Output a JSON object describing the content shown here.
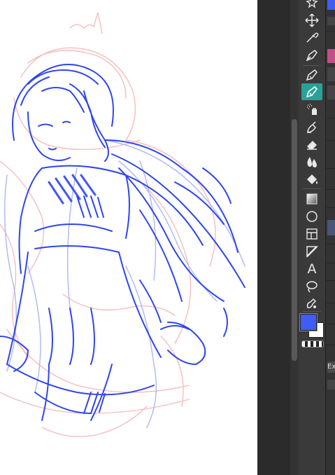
{
  "toolbar": {
    "tools": [
      {
        "name": "magic-wand-icon"
      },
      {
        "name": "move-icon"
      },
      {
        "name": "eyedropper-icon"
      },
      {
        "name": "pen-icon"
      },
      {
        "name": "pencil-icon"
      },
      {
        "name": "brush-icon",
        "active": true
      },
      {
        "name": "airbrush-icon"
      },
      {
        "name": "blend-icon"
      },
      {
        "name": "eraser-icon"
      },
      {
        "name": "water-drop-icon"
      },
      {
        "name": "fill-bucket-icon"
      },
      {
        "name": "gradient-icon"
      },
      {
        "name": "ellipse-icon"
      },
      {
        "name": "frame-border-icon"
      },
      {
        "name": "ruler-icon"
      },
      {
        "name": "text-icon"
      },
      {
        "name": "lasso-icon"
      },
      {
        "name": "correct-line-icon"
      }
    ],
    "text_tool_glyph": "A",
    "primary_color": "#3f5cf4",
    "secondary_color": "#ffffff",
    "active_tool_color": "#2aa198"
  },
  "right_panel": {
    "text_fragment": "Ex"
  },
  "canvas": {
    "sketch_colors": [
      "#2f45ee",
      "#f4b6b6"
    ]
  }
}
